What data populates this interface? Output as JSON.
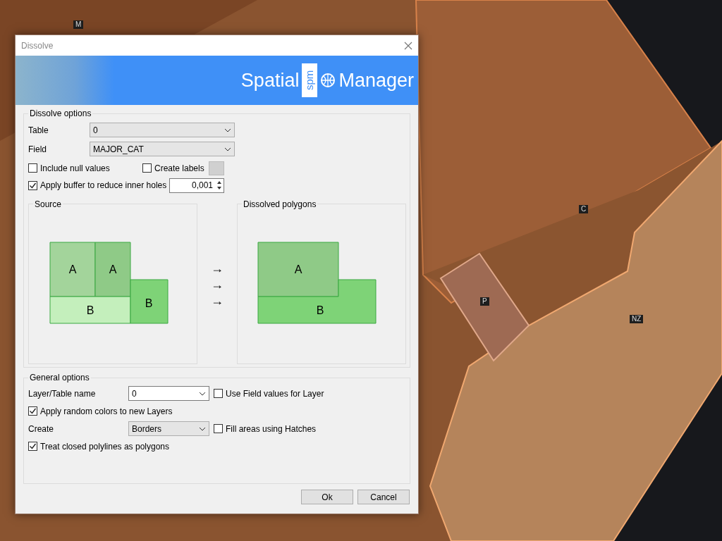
{
  "map": {
    "labels": [
      {
        "text": "M"
      },
      {
        "text": "C"
      },
      {
        "text": "P"
      },
      {
        "text": "NZ"
      }
    ]
  },
  "window": {
    "title": "Dissolve"
  },
  "banner": {
    "logo_left": "Spatial",
    "logo_mark": "spm",
    "logo_right": "Manager"
  },
  "dissolve_options": {
    "title": "Dissolve options",
    "table": {
      "label": "Table",
      "value": "0"
    },
    "field": {
      "label": "Field",
      "value": "MAJOR_CAT"
    },
    "include_null": {
      "label": "Include null values",
      "checked": false
    },
    "create_labels": {
      "label": "Create labels",
      "checked": false
    },
    "buffer": {
      "label": "Apply buffer to reduce inner holes",
      "checked": true,
      "value": "0,001"
    }
  },
  "preview": {
    "source": {
      "title": "Source",
      "shapes": [
        {
          "label": "A",
          "color": "#a3d49b"
        },
        {
          "label": "A",
          "color": "#8fca87"
        },
        {
          "label": "B",
          "color": "#c4efbc"
        },
        {
          "label": "B",
          "color": "#7ed377"
        }
      ]
    },
    "arrows": [
      "→",
      "→",
      "→"
    ],
    "dissolved": {
      "title": "Dissolved polygons",
      "shapes": [
        {
          "label": "A",
          "color": "#8fca87"
        },
        {
          "label": "B",
          "color": "#7ed377"
        }
      ]
    }
  },
  "general_options": {
    "title": "General options",
    "layer_name": {
      "label": "Layer/Table name",
      "value": "0"
    },
    "use_field_values": {
      "label": "Use Field values for Layer",
      "checked": false
    },
    "random_colors": {
      "label": "Apply random colors to new Layers",
      "checked": true
    },
    "create": {
      "label": "Create",
      "value": "Borders"
    },
    "fill_hatches": {
      "label": "Fill areas using Hatches",
      "checked": false
    },
    "treat_closed": {
      "label": "Treat closed polylines as polygons",
      "checked": true
    }
  },
  "buttons": [
    {
      "label": "Ok"
    },
    {
      "label": "Cancel"
    }
  ]
}
